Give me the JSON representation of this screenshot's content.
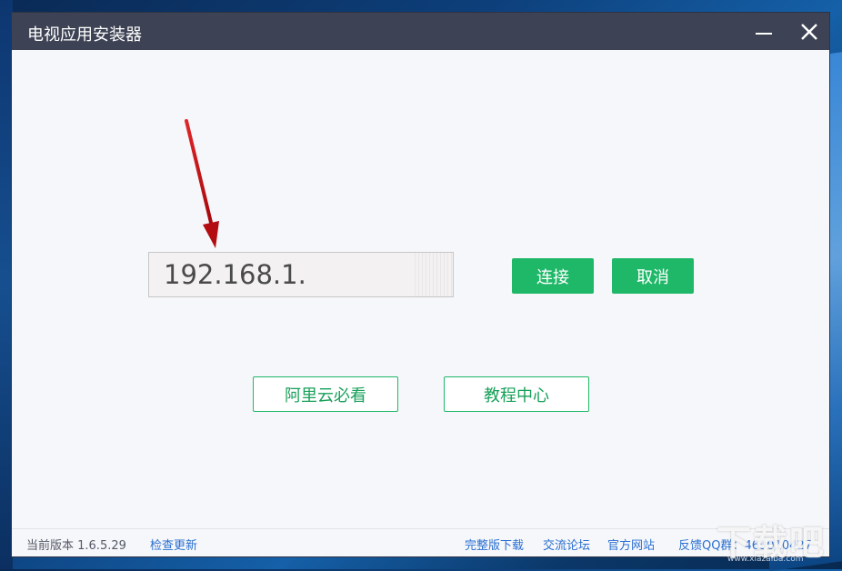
{
  "window": {
    "title": "电视应用安装器",
    "minimize_icon": "minimize-icon",
    "close_icon": "close-icon"
  },
  "connection": {
    "ip_value": "192.168.1.",
    "connect_label": "连接",
    "cancel_label": "取消"
  },
  "links": {
    "aliyun_label": "阿里云必看",
    "tutorial_label": "教程中心"
  },
  "statusbar": {
    "version": "当前版本 1.6.5.29",
    "check_update": "检查更新",
    "full_download": "完整版下载",
    "forum": "交流论坛",
    "official_site": "官方网站",
    "qq_group": "反馈QQ群：469010427"
  },
  "watermark": {
    "text": "下载吧",
    "sub": "www.xiazaiba.com"
  },
  "colors": {
    "titlebar": "#3d4354",
    "accent_green": "#1fb868",
    "link_blue": "#2a6fd1",
    "arrow_red": "#c0161a"
  }
}
